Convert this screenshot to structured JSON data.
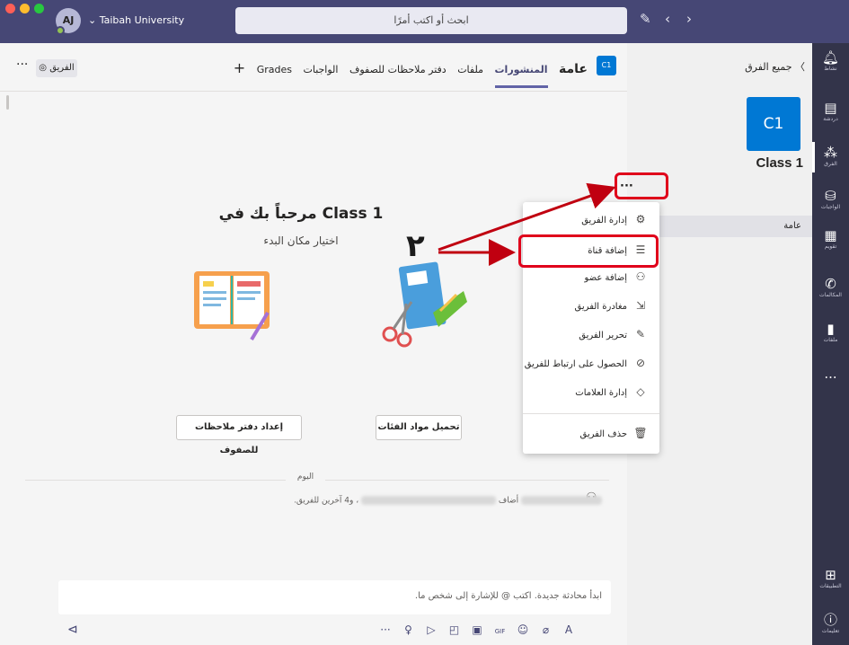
{
  "titlebar": {
    "avatar_initials": "AJ",
    "org_name": "Taibah University",
    "search_placeholder": "ابحث أو اكتب أمرًا",
    "compose_icon": "compose-icon",
    "back_icon": "chevron-left-icon",
    "forward_icon": "chevron-right-icon"
  },
  "rail": {
    "items": [
      {
        "label": "نشاط",
        "icon": "bell-icon"
      },
      {
        "label": "دردشة",
        "icon": "chat-icon"
      },
      {
        "label": "الفرق",
        "icon": "teams-icon"
      },
      {
        "label": "الواجبات",
        "icon": "assignments-icon"
      },
      {
        "label": "تقويم",
        "icon": "calendar-icon"
      },
      {
        "label": "المكالمات",
        "icon": "phone-icon"
      },
      {
        "label": "ملفات",
        "icon": "files-icon"
      },
      {
        "label": "...",
        "icon": "more-icon"
      }
    ],
    "apps_label": "التطبيقات",
    "help_label": "تعليمات"
  },
  "panel": {
    "all_teams": "جميع الفرق",
    "tile_text": "C1",
    "team_name": "Class 1",
    "channel": "عامة"
  },
  "header": {
    "badge": "C1",
    "title": "عامة",
    "tabs": [
      "المنشورات",
      "ملفات",
      "دفتر ملاحظات للصفوف",
      "الواجبات",
      "Grades"
    ],
    "add_tab": "+",
    "team_button": "◎ الفريق",
    "more": "···"
  },
  "welcome": {
    "title": "مرحباً بك في Class 1",
    "subtitle": "اختيار مكان البدء",
    "card_upload": "تحميل مواد الفئات",
    "card_notebook": "إعداد دفتر ملاحظات للصفوف"
  },
  "feed": {
    "today": "اليوم",
    "added": "أضاف",
    "others": "، و4 آخرين للفريق."
  },
  "compose": {
    "placeholder": "ابدأ محادثة جديدة. اكتب @ للإشارة إلى شخص ما.",
    "tools": [
      "format-icon",
      "attach-icon",
      "emoji-icon",
      "gif-icon",
      "sticker-icon",
      "meet-icon",
      "stream-icon",
      "praise-icon",
      "more-icon"
    ],
    "tool_glyphs": [
      "A",
      "⌀",
      "☺",
      "GIF",
      "▣",
      "◰",
      "▷",
      "♀",
      "···"
    ],
    "send": "send-icon"
  },
  "menu": {
    "dots": "···",
    "items": [
      {
        "label": "إدارة الفريق",
        "icon": "⚙"
      },
      {
        "label": "إضافة قناة",
        "icon": "☰"
      },
      {
        "label": "إضافة عضو",
        "icon": "⚇"
      },
      {
        "label": "مغادرة الفريق",
        "icon": "⇲"
      },
      {
        "label": "تحرير الفريق",
        "icon": "✎"
      },
      {
        "label": "الحصول على ارتباط للفريق",
        "icon": "⊘"
      },
      {
        "label": "إدارة العلامات",
        "icon": "◇"
      },
      {
        "label": "حذف الفريق",
        "icon": "🗑"
      }
    ]
  },
  "annotation": {
    "number": "٢",
    "color": "#e0001b"
  }
}
